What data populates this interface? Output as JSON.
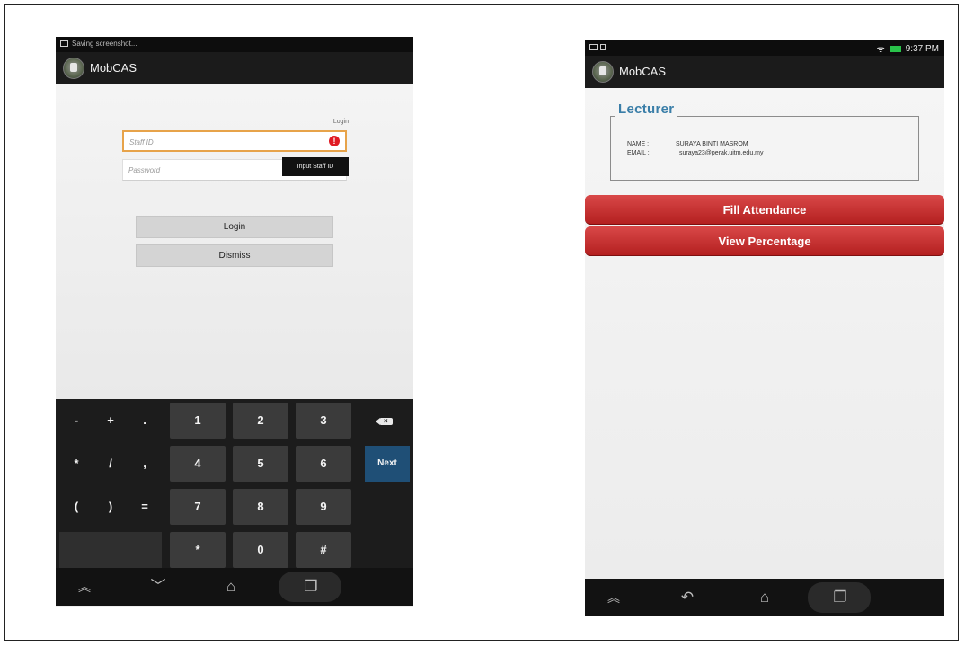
{
  "login_screen": {
    "status": {
      "text": "Saving screenshot..."
    },
    "app_title": "MobCAS",
    "login_label": "Login",
    "staff_id": {
      "placeholder": "Staff ID",
      "value": ""
    },
    "password": {
      "placeholder": "Password",
      "value": ""
    },
    "error_tooltip": "Input Staff ID",
    "buttons": {
      "login": "Login",
      "dismiss": "Dismiss"
    },
    "keyboard": {
      "row1": [
        "-",
        "+",
        ".",
        "1",
        "2",
        "3",
        "⌫"
      ],
      "row2": [
        "*",
        "/",
        ",",
        "4",
        "5",
        "6",
        "Next"
      ],
      "row3": [
        "(",
        ")",
        "=",
        "7",
        "8",
        "9"
      ],
      "row4": [
        "*",
        "0",
        "#"
      ]
    }
  },
  "lecturer_screen": {
    "status": {
      "time": "9:37 PM"
    },
    "app_title": "MobCAS",
    "section_title": "Lecturer",
    "name_label": "NAME :",
    "name_value": "SURAYA BINTI MASROM",
    "email_label": "EMAIL :",
    "email_value": "suraya23@perak.uitm.edu.my",
    "buttons": {
      "fill_attendance": "Fill Attendance",
      "view_percentage": "View Percentage"
    }
  },
  "colors": {
    "error_red": "#e01b24",
    "input_focus": "#e7a34a",
    "next_key": "#1f4f76",
    "primary_red": "#c62828",
    "legend_blue": "#3a7ea8"
  },
  "icons": {
    "nav": [
      "back-icon",
      "home-icon",
      "recents-icon"
    ],
    "status": [
      "screenshot-icon",
      "wifi-icon",
      "battery-icon"
    ]
  }
}
